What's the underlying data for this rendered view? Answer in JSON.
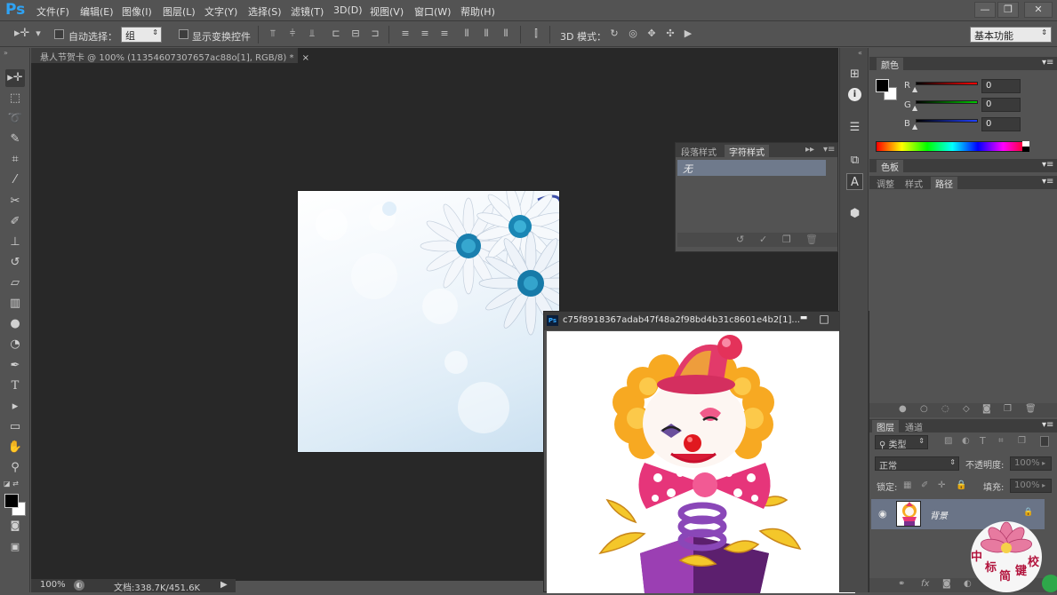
{
  "app": {
    "logo": "Ps"
  },
  "menu": {
    "items": [
      "文件(F)",
      "编辑(E)",
      "图像(I)",
      "图层(L)",
      "文字(Y)",
      "选择(S)",
      "滤镜(T)",
      "3D(D)",
      "视图(V)",
      "窗口(W)",
      "帮助(H)"
    ]
  },
  "window_controls": {
    "minimize": "—",
    "restore": "❐",
    "close": "✕"
  },
  "options_bar": {
    "auto_select_label": "自动选择：",
    "auto_select_value": "组",
    "show_transform_label": "显示变换控件",
    "mode_3d_label": "3D 模式：",
    "workspace_value": "基本功能"
  },
  "document": {
    "tab_title": "悬人节贺卡 @ 100% (11354607307657ac88o[1], RGB/8) *",
    "tab_close": "×"
  },
  "status_bar": {
    "zoom": "100%",
    "doc_info": "文档:338.7K/451.6K"
  },
  "char_panel": {
    "tab_paragraph_styles": "段落样式",
    "tab_character_styles": "字符样式",
    "item_none": "无"
  },
  "image_window": {
    "title": "c75f8918367adab47f48a2f98bd4b31c8601e4b2[1]...",
    "minimize": "▬",
    "restore": "□",
    "close": "✕"
  },
  "color_panel": {
    "title": "颜色",
    "r_label": "R",
    "r_value": "0",
    "g_label": "G",
    "g_value": "0",
    "b_label": "B",
    "b_value": "0"
  },
  "swatches_panel": {
    "title": "色板"
  },
  "paths_panel": {
    "tab_adjust": "调整",
    "tab_styles": "样式",
    "tab_paths": "路径"
  },
  "layers_panel": {
    "tab_layers": "图层",
    "tab_channels": "通道",
    "filter_kind": "类型",
    "blend_mode": "正常",
    "opacity_label": "不透明度:",
    "opacity_value": "100%",
    "lock_label": "锁定:",
    "fill_label": "填充:",
    "fill_value": "100%",
    "layer_name": "背景"
  },
  "watermark": {
    "text": "中标简键校"
  },
  "colors": {
    "ui_bg": "#535353",
    "canvas_bg": "#282828",
    "ps_blue": "#2fa3f4"
  }
}
